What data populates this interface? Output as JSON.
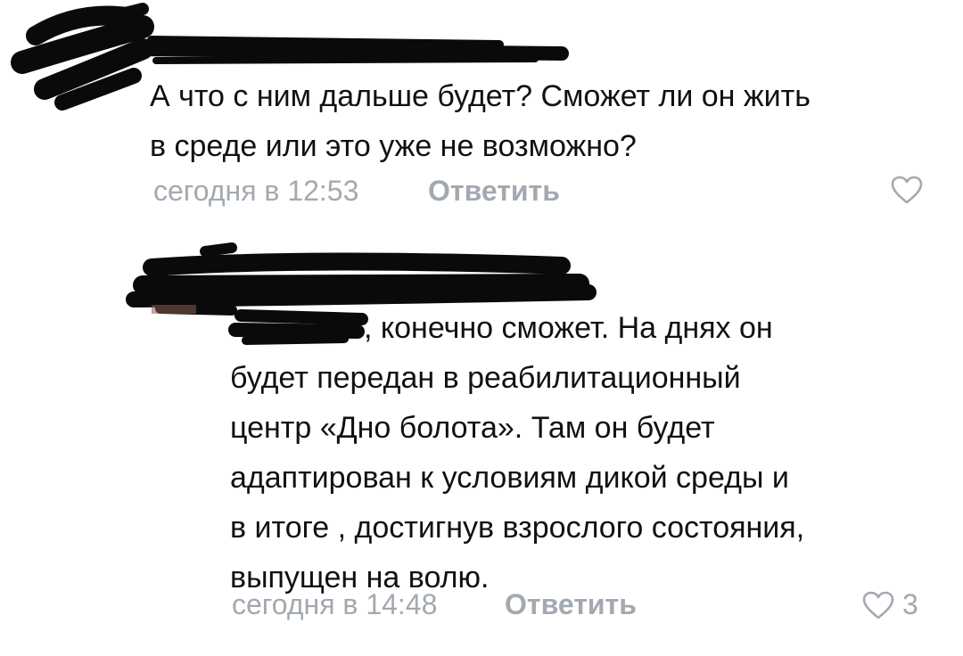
{
  "comments": [
    {
      "text_lines": [
        "А что с ним дальше будет? Сможет ли он жить",
        "в среде или это уже не возможно?"
      ],
      "time": "сегодня в 12:53",
      "reply_label": "Ответить"
    },
    {
      "text_lines": [
        ", конечно сможет. На днях он",
        "будет передан в реабилитационный",
        "центр «Дно болота». Там он будет",
        "адаптирован к условиям дикой среды и",
        "в итоге , достигнув взрослого состояния,",
        "выпущен на волю."
      ],
      "time": "сегодня в 14:48",
      "reply_label": "Ответить",
      "likes": "3"
    }
  ],
  "icons": {
    "like": "heart-outline-icon"
  },
  "colors": {
    "text": "#111111",
    "meta": "#a3a9b1",
    "redaction": "#0a0a0a",
    "background": "#ffffff"
  }
}
